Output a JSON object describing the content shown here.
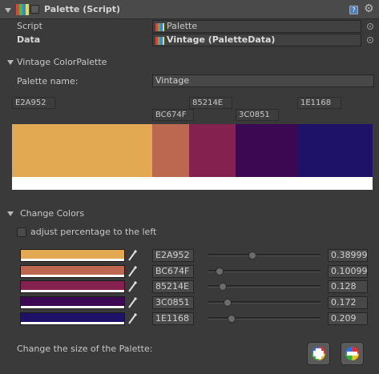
{
  "component": {
    "title": "Palette (Script)",
    "icon": "palette-script-icon",
    "help_icon": "?"
  },
  "props": {
    "script_label": "Script",
    "script_value": "Palette",
    "data_label": "Data",
    "data_value": "Vintage (PaletteData)"
  },
  "section1": {
    "title": "Vintage ColorPalette",
    "name_label": "Palette name:",
    "name_value": "Vintage"
  },
  "palette": {
    "colors": [
      {
        "hex": "E2A952",
        "color": "#E2A952",
        "percent": "0.38999",
        "fraction": 0.38999
      },
      {
        "hex": "BC674F",
        "color": "#BC674F",
        "percent": "0.10099",
        "fraction": 0.10099
      },
      {
        "hex": "85214E",
        "color": "#85214E",
        "percent": "0.128",
        "fraction": 0.128
      },
      {
        "hex": "3C0851",
        "color": "#3C0851",
        "percent": "0.172",
        "fraction": 0.172
      },
      {
        "hex": "1E1168",
        "color": "#1E1168",
        "percent": "0.209",
        "fraction": 0.209
      }
    ]
  },
  "section2": {
    "title": "Change Colors",
    "adjust_label": "adjust percentage to the left",
    "adjust_checked": false,
    "size_label": "Change the size of the Palette:",
    "add_button_icon": "plus-icon",
    "remove_button_icon": "minus-icon"
  }
}
